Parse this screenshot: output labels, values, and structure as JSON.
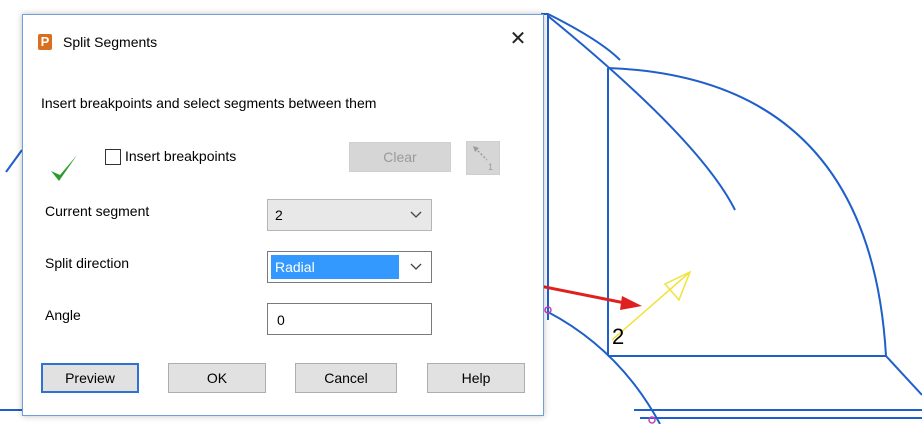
{
  "dialog": {
    "title": "Split Segments",
    "app_icon_letter": "P",
    "close_glyph": "✕",
    "instruction": "Insert breakpoints and select segments between them",
    "insert_breakpoints_label": "Insert breakpoints",
    "insert_breakpoints_checked": false,
    "clear_label": "Clear",
    "current_segment_label": "Current segment",
    "current_segment_value": "2",
    "split_direction_label": "Split direction",
    "split_direction_value": "Radial",
    "angle_label": "Angle",
    "angle_value": "0",
    "buttons": {
      "preview": "Preview",
      "ok": "OK",
      "cancel": "Cancel",
      "help": "Help"
    }
  },
  "viewport": {
    "segment_label": "2"
  },
  "colors": {
    "geometry": "#1f5fc9",
    "arrow": "#e02020",
    "direction_arrow": "#f2e23a",
    "accept_check": "#2e9b2e",
    "selection": "#3399ff"
  }
}
